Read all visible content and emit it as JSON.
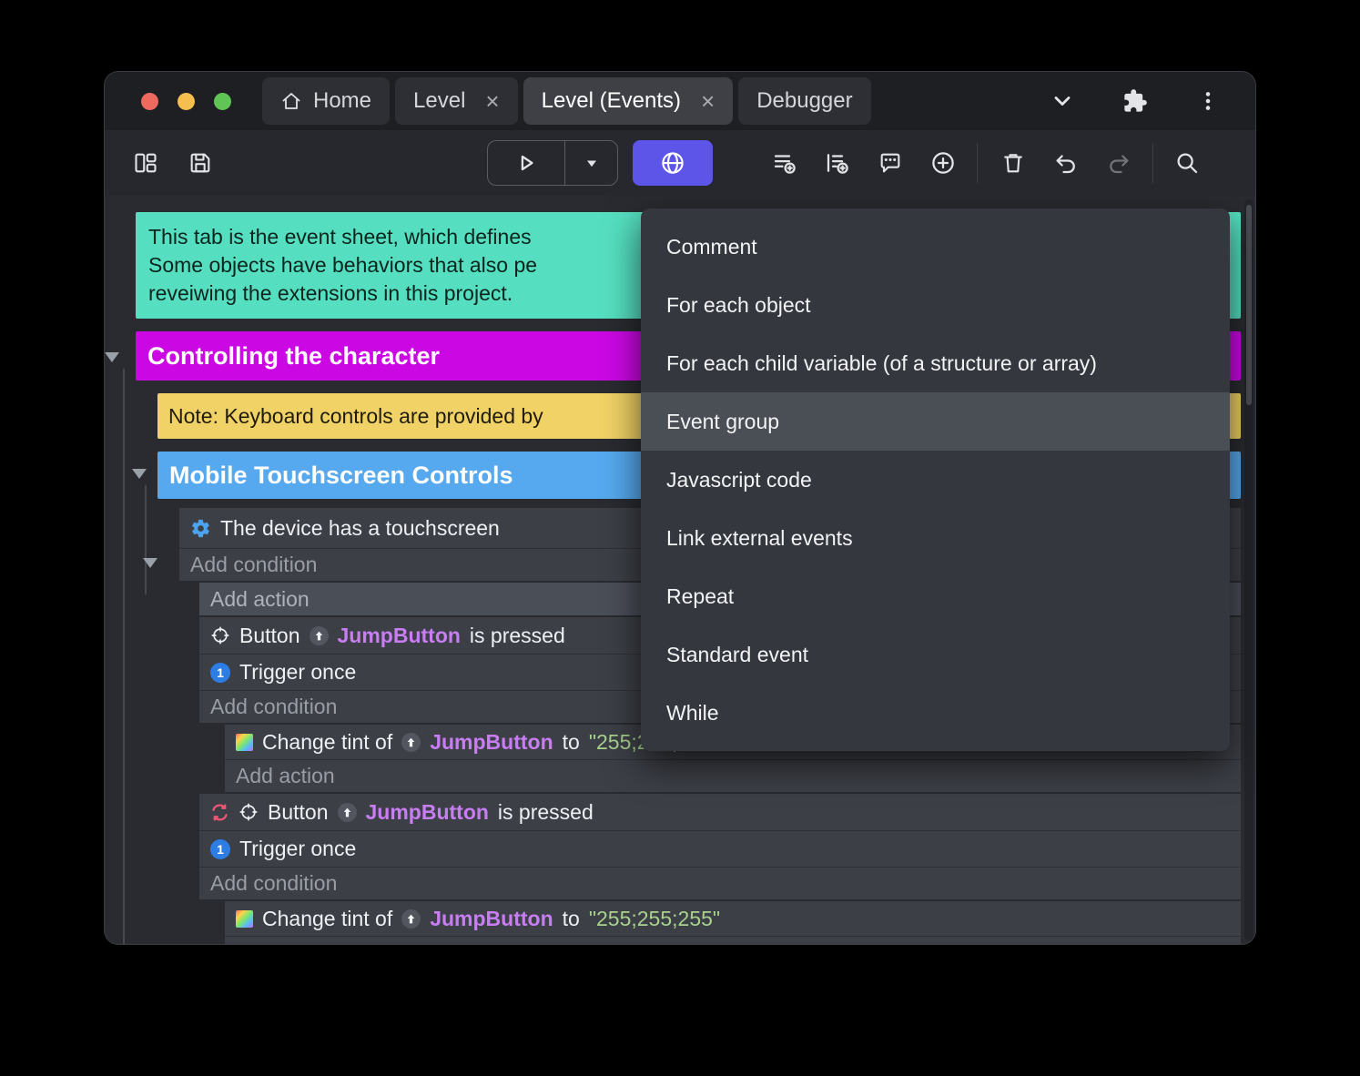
{
  "window": {
    "tabs": [
      {
        "label": "Home",
        "active": false
      },
      {
        "label": "Level",
        "active": false
      },
      {
        "label": "Level (Events)",
        "active": true
      },
      {
        "label": "Debugger",
        "active": false
      }
    ],
    "close_glyph": "×"
  },
  "sheet": {
    "comment_line1": "This tab is the event sheet, which defines",
    "comment_line2": "Some objects have behaviors that also pe",
    "comment_line3": "reveiwing the extensions in this project.",
    "group_character": "Controlling the character",
    "note_keyboard": "Note: Keyboard controls are provided by",
    "group_mobile": "Mobile Touchscreen Controls",
    "cond_touchscreen": "The device has a touchscreen",
    "add_condition": "Add condition",
    "add_action": "Add action",
    "trigger_once": "Trigger once",
    "btn_prefix": "Button",
    "btn_object": "JumpButton",
    "btn_suffix": "is pressed",
    "tint_prefix": "Change tint of",
    "tint_object": "JumpButton",
    "tint_to": "to",
    "tint_value": "\"255;255;255\""
  },
  "context_menu": {
    "items": [
      "Comment",
      "For each object",
      "For each child variable (of a structure or array)",
      "Event group",
      "Javascript code",
      "Link external events",
      "Repeat",
      "Standard event",
      "While"
    ],
    "highlighted": "Event group"
  },
  "colors": {
    "accent_button": "#5d55e8",
    "comment_block": "#55dfc0",
    "group_magenta": "#cb08e4",
    "note_yellow": "#f0d266",
    "group_blue": "#56a9ee",
    "object_name": "#c87ef2",
    "string_value": "#a9d18e",
    "menu_highlight": "#4a4e55"
  }
}
